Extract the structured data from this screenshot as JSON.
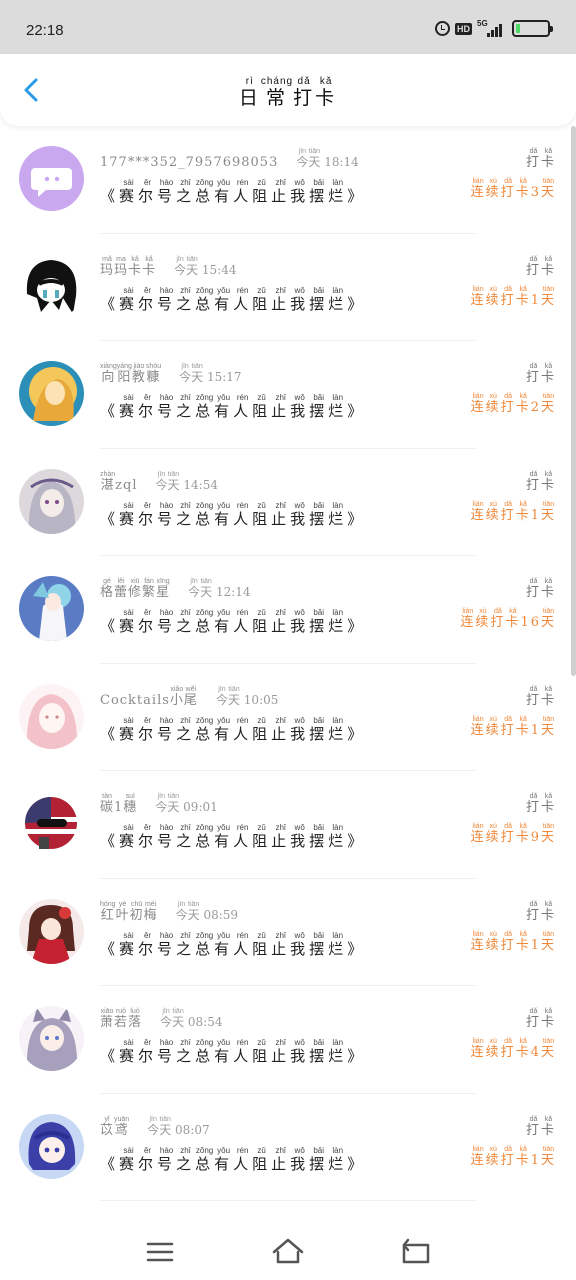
{
  "status_bar": {
    "time": "22:18",
    "net_label": "5G",
    "hd_label": "HD",
    "icons": [
      "alarm-icon",
      "hd-icon",
      "5g-signal-icon",
      "battery-icon"
    ],
    "battery_color": "#4cd964"
  },
  "header": {
    "back_icon": "chevron-left-icon",
    "title": [
      {
        "c": "日",
        "p": "rì"
      },
      {
        "c": "常",
        "p": "cháng"
      },
      {
        "c": "打",
        "p": "dǎ"
      },
      {
        "c": "卡",
        "p": "kǎ"
      }
    ]
  },
  "accent_color": "#f0883a",
  "items": [
    {
      "name": "177***352_7957698053",
      "time": "18:14",
      "name_ruby": [],
      "days": "3",
      "avatar": "chat-bubble-avatar"
    },
    {
      "name": "玛玛卡卡",
      "time": "15:44",
      "name_ruby": [
        {
          "c": "玛",
          "p": "mǎ"
        },
        {
          "c": "玛",
          "p": "ma"
        },
        {
          "c": "卡",
          "p": "kǎ"
        },
        {
          "c": "卡",
          "p": "kǎ"
        }
      ],
      "days": "1",
      "avatar": "black-hair-avatar"
    },
    {
      "name": "向阳教糠",
      "time": "15:17",
      "name_ruby": [
        {
          "c": "向",
          "p": "xiàng"
        },
        {
          "c": "阳",
          "p": "yáng"
        },
        {
          "c": "教",
          "p": "jiào"
        },
        {
          "c": "糠",
          "p": "shòu"
        }
      ],
      "days": "2",
      "avatar": "golden-avatar"
    },
    {
      "name": "湛zql",
      "time": "14:54",
      "name_ruby": [
        {
          "c": "湛",
          "p": "zhàn"
        },
        {
          "c": "zql",
          "p": ""
        }
      ],
      "days": "1",
      "avatar": "silver-hair-avatar"
    },
    {
      "name": "格蕾修繁星",
      "time": "12:14",
      "name_ruby": [
        {
          "c": "格",
          "p": "gé"
        },
        {
          "c": "蕾",
          "p": "lěi"
        },
        {
          "c": "修",
          "p": "xiū"
        },
        {
          "c": "繁",
          "p": "fán"
        },
        {
          "c": "星",
          "p": "xīng"
        }
      ],
      "days": "16",
      "avatar": "blue-anime-avatar"
    },
    {
      "name": "Cocktails小尾",
      "time": "10:05",
      "name_ruby": [
        {
          "c": "Cocktails",
          "p": ""
        },
        {
          "c": "小",
          "p": "xiǎo"
        },
        {
          "c": "尾",
          "p": "wěi"
        }
      ],
      "days": "1",
      "avatar": "pink-sketch-avatar"
    },
    {
      "name": "碳1穗",
      "time": "09:01",
      "name_ruby": [
        {
          "c": "碳",
          "p": "tàn"
        },
        {
          "c": "1",
          "p": ""
        },
        {
          "c": "穗",
          "p": "suì"
        }
      ],
      "days": "9",
      "avatar": "flag-ball-avatar"
    },
    {
      "name": "红叶初梅",
      "time": "08:59",
      "name_ruby": [
        {
          "c": "红",
          "p": "hóng"
        },
        {
          "c": "叶",
          "p": "yè"
        },
        {
          "c": "初",
          "p": "chū"
        },
        {
          "c": "梅",
          "p": "méi"
        }
      ],
      "days": "1",
      "avatar": "red-dress-avatar"
    },
    {
      "name": "萧若落",
      "time": "08:54",
      "name_ruby": [
        {
          "c": "萧",
          "p": "xiāo"
        },
        {
          "c": "若",
          "p": "ruò"
        },
        {
          "c": "落",
          "p": "luò"
        }
      ],
      "days": "4",
      "avatar": "cat-ear-avatar"
    },
    {
      "name": "苡鸢",
      "time": "08:07",
      "name_ruby": [
        {
          "c": "苡",
          "p": "yǐ"
        },
        {
          "c": "鸢",
          "p": "yuān"
        }
      ],
      "days": "1",
      "avatar": "purple-hair-avatar"
    }
  ],
  "common": {
    "today": [
      {
        "c": "今",
        "p": "jīn"
      },
      {
        "c": "天",
        "p": "tiān"
      }
    ],
    "punch": [
      {
        "c": "打",
        "p": "dǎ"
      },
      {
        "c": "卡",
        "p": "kǎ"
      }
    ],
    "content": [
      {
        "c": "《",
        "p": ""
      },
      {
        "c": "赛",
        "p": "sài"
      },
      {
        "c": "尔",
        "p": "ěr"
      },
      {
        "c": "号",
        "p": "hào"
      },
      {
        "c": "之",
        "p": "zhī"
      },
      {
        "c": "总",
        "p": "zǒng"
      },
      {
        "c": "有",
        "p": "yǒu"
      },
      {
        "c": "人",
        "p": "rén"
      },
      {
        "c": "阻",
        "p": "zǔ"
      },
      {
        "c": "止",
        "p": "zhǐ"
      },
      {
        "c": "我",
        "p": "wǒ"
      },
      {
        "c": "摆",
        "p": "bǎi"
      },
      {
        "c": "烂",
        "p": "làn"
      },
      {
        "c": "》",
        "p": ""
      }
    ],
    "streak_prefix": [
      {
        "c": "连",
        "p": "lián"
      },
      {
        "c": "续",
        "p": "xù"
      },
      {
        "c": "打",
        "p": "dǎ"
      },
      {
        "c": "卡",
        "p": "kǎ"
      }
    ],
    "streak_suffix": [
      {
        "c": "天",
        "p": "tiān"
      }
    ]
  },
  "bottom_nav": {
    "icons": [
      "menu-icon",
      "home-icon",
      "back-arrow-icon"
    ]
  }
}
